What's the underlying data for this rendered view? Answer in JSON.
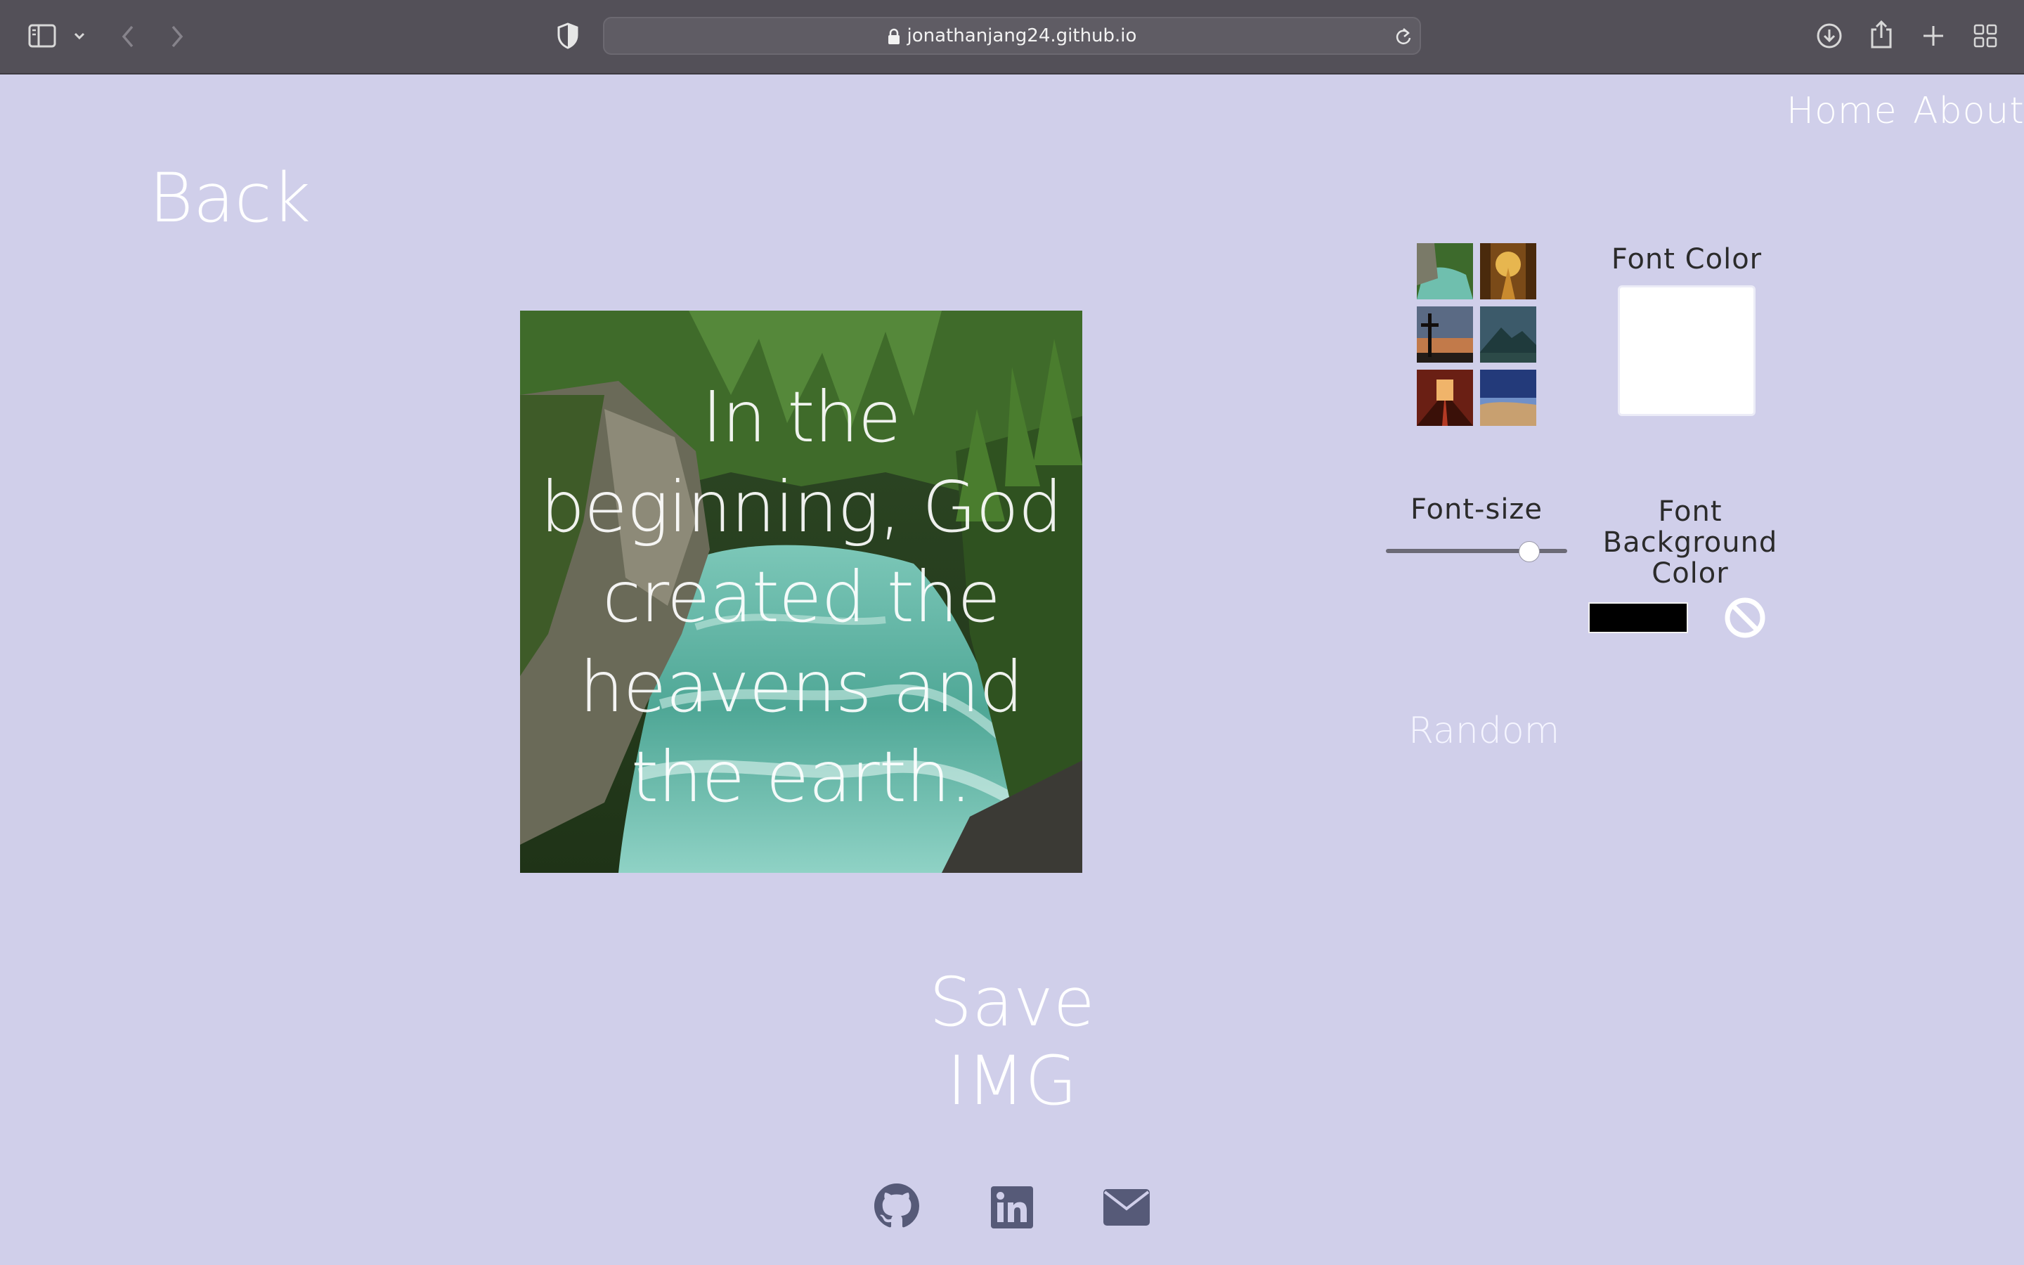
{
  "browser": {
    "url": "jonathanjang24.github.io"
  },
  "nav": {
    "home": "Home",
    "about": "About"
  },
  "page": {
    "back": "Back",
    "verse": "In the beginning, God created the heavens and the earth.",
    "save": "Save IMG",
    "random": "Random"
  },
  "controls": {
    "font_color_label": "Font Color",
    "font_color": "#ffffff",
    "font_size_label": "Font-size",
    "font_size_position": 0.79,
    "font_bg_label": "Font Background Color",
    "font_bg_color": "#000000"
  },
  "backgrounds": [
    "river",
    "forest-path",
    "cross-sunset",
    "mountains",
    "church-aisle",
    "desert-night"
  ],
  "social": [
    "github-icon",
    "linkedin-icon",
    "email-icon"
  ],
  "colors": {
    "page_background": "#d0cfea",
    "toolbar": "#535058",
    "social_icon": "#565a78"
  }
}
